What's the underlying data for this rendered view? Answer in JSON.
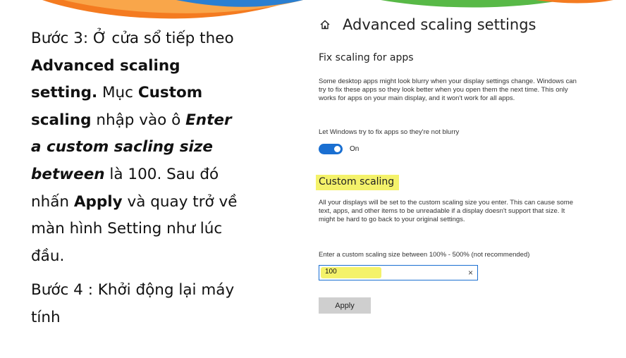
{
  "slide": {
    "step3_prefix": "Bước 3: Ở cửa sổ tiếp theo ",
    "step3_bold1": "Advanced scaling setting.",
    "step3_mid1": " Mục ",
    "step3_bold2": "Custom scaling",
    "step3_mid2": " nhập vào ô ",
    "step3_italic": "Enter a custom sacling size between",
    "step3_mid3": " là 100. Sau đó nhấn ",
    "step3_bold3": "Apply",
    "step3_suffix": " và quay trở về màn hình Setting như lúc đầu.",
    "step4": "Bước 4 : Khởi động lại máy tính"
  },
  "settings": {
    "header_icon": "home-icon",
    "title": "Advanced scaling settings",
    "fix_section": {
      "title": "Fix scaling for apps",
      "description": "Some desktop apps might look blurry when your display settings change. Windows can try to fix these apps so they look better when you open them the next time. This only works for apps on your main display, and it won't work for all apps.",
      "toggle_caption": "Let Windows try to fix apps so they're not blurry",
      "toggle_state": "On",
      "toggle_on": true
    },
    "custom_section": {
      "title": "Custom scaling",
      "description": "All your displays will be set to the custom scaling size you enter. This can cause some text, apps, and other items to be unreadable if a display doesn't support that size. It might be hard to go back to your original settings.",
      "input_label": "Enter a custom scaling size between 100% - 500% (not recommended)",
      "input_value": "100",
      "clear_glyph": "×",
      "apply_label": "Apply"
    }
  },
  "colors": {
    "accent": "#1a6fd1",
    "highlight": "#f4f26a",
    "button_bg": "#cfcfcf"
  }
}
